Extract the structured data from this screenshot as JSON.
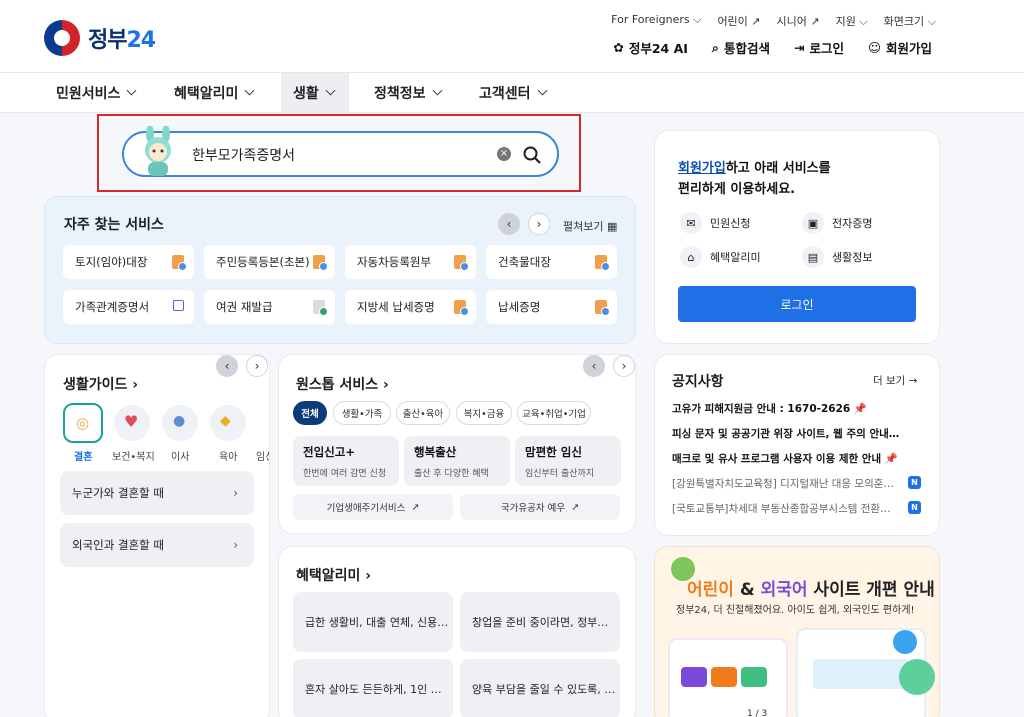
{
  "brand": {
    "name": "정부",
    "num": "24"
  },
  "utils": [
    "For Foreigners ⌵",
    "어린이 ↗",
    "시니어 ↗",
    "지원 ⌵",
    "화면크기 ⌵"
  ],
  "topnav": [
    "정부24 AI",
    "통합검색",
    "로그인",
    "회원가입"
  ],
  "gnb": [
    "민원서비스",
    "혜택알리미",
    "생활",
    "정책정보",
    "고객센터"
  ],
  "search": {
    "value": "한부모가족증명서",
    "clear": "×"
  },
  "faq": {
    "title": "자주 찾는 서비스",
    "spread": "펼쳐보기",
    "items": [
      "토지(임야)대장",
      "주민등록등본(초본)",
      "자동차등록원부",
      "건축물대장",
      "가족관계증명서",
      "여권 재발급",
      "지방세 납세증명",
      "납세증명"
    ]
  },
  "guide": {
    "title": "생활가이드",
    "cats": [
      "결혼",
      "보건•복지",
      "이사",
      "육아",
      "임신"
    ],
    "rows": [
      "누군가와 결혼할 때",
      "외국인과 결혼할 때"
    ]
  },
  "onestop": {
    "title": "원스톱 서비스",
    "chips": [
      "전체",
      "생활•가족",
      "출산•육아",
      "복지•금융",
      "교육•취업•기업"
    ],
    "boxes": [
      {
        "t": "전입신고+",
        "s": "한번에 여러 감면 신청"
      },
      {
        "t": "행복출산",
        "s": "출산 후 다양한 혜택"
      },
      {
        "t": "맘편한 임신",
        "s": "임신부터 출산까지"
      }
    ],
    "links": [
      "기업생애주기서비스",
      "국가유공자 예우"
    ]
  },
  "benefit": {
    "title": "혜택알리미",
    "items": [
      "급한 생활비, 대출 연체, 신용…",
      "창업을 준비 중이라면, 정부…",
      "혼자 살아도 든든하게, 1인 …",
      "양육 부담을 줄일 수 있도록, …"
    ]
  },
  "login": {
    "msg_u": "회원가입",
    "msg1": "하고 아래 서비스를",
    "msg2": "편리하게 이용하세요.",
    "quick": [
      "민원신청",
      "전자증명",
      "혜택알리미",
      "생활정보"
    ],
    "button": "로그인"
  },
  "notice": {
    "title": "공지사항",
    "more": "더 보기 →",
    "items": [
      "고유가 피해지원금 안내 : 1670-2626 📌",
      "피싱 문자 및 공공기관 위장 사이트, 웹 주의 안내 📌",
      "매크로 및 유사 프로그램 사용자 이용 제한 안내 📌",
      "[강원특별자치도교육청] 디지털재난 대응 모의훈…",
      "[국토교통부]차세대 부동산종합공부시스템 전환…"
    ],
    "badge": "N"
  },
  "banner": {
    "t1": "어린이",
    "amp": " & ",
    "t2": "외국어",
    "t3": " 사이트 개편 안내",
    "sub": "정부24, 더 친절해졌어요. 아이도 쉽게, 외국인도 편하게!",
    "pager": "1 / 3"
  }
}
